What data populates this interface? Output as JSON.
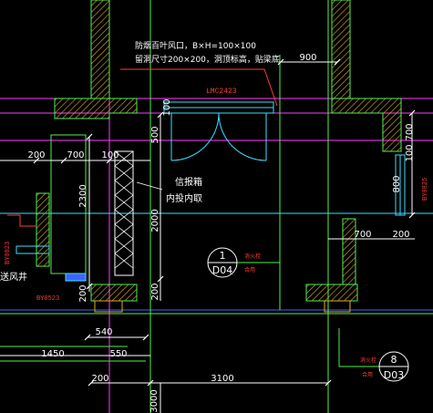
{
  "colors": {
    "background": "#000000",
    "wall_hatch": "#e0b020",
    "wall_edge": "#4ff04f",
    "dimension": "#ffffff",
    "dim_extension": "#4ff04f",
    "grid_magenta": "#ff3cff",
    "cyan": "#3ce0ff",
    "red_text": "#ff3c3c",
    "blue": "#3c64ff"
  },
  "notes": {
    "vent_line1": "防烟百叶风口，B×H=100×100",
    "vent_line2": "留洞尺寸200×200，洞顶标高，贴梁底",
    "box_line1": "信报箱",
    "box_line2": "内投内取",
    "air_shaft": "送风井",
    "sub_label_1": "消火栓",
    "sub_label_2": "合用",
    "sub_label_3": "消火栓",
    "sub_label_4": "合用"
  },
  "tags": {
    "door_main": "LMC2423",
    "window_left": "BY0823",
    "window_left2": "BY0523",
    "window_right": "BY0825"
  },
  "dimensions": {
    "d_900": "900",
    "d_200_left": "200",
    "d_700_left": "700",
    "d_100_left": "100",
    "d_2300": "2300",
    "d_2000": "2000",
    "d_500": "500",
    "d_100_mid": "100",
    "d_200_mid": "200",
    "d_200_lower": "200",
    "d_540": "540",
    "d_1450": "1450",
    "d_550": "550",
    "d_200_bottom": "200",
    "d_3100": "3100",
    "d_3000": "3000",
    "d_700_right": "700",
    "d_200_right": "200",
    "d_700_vert": "700",
    "d_100_vert": "100",
    "d_800_vert": "800"
  },
  "callouts": {
    "c1_num": "1",
    "c1_sheet": "D04",
    "c2_num": "8",
    "c2_sheet": "D03"
  }
}
